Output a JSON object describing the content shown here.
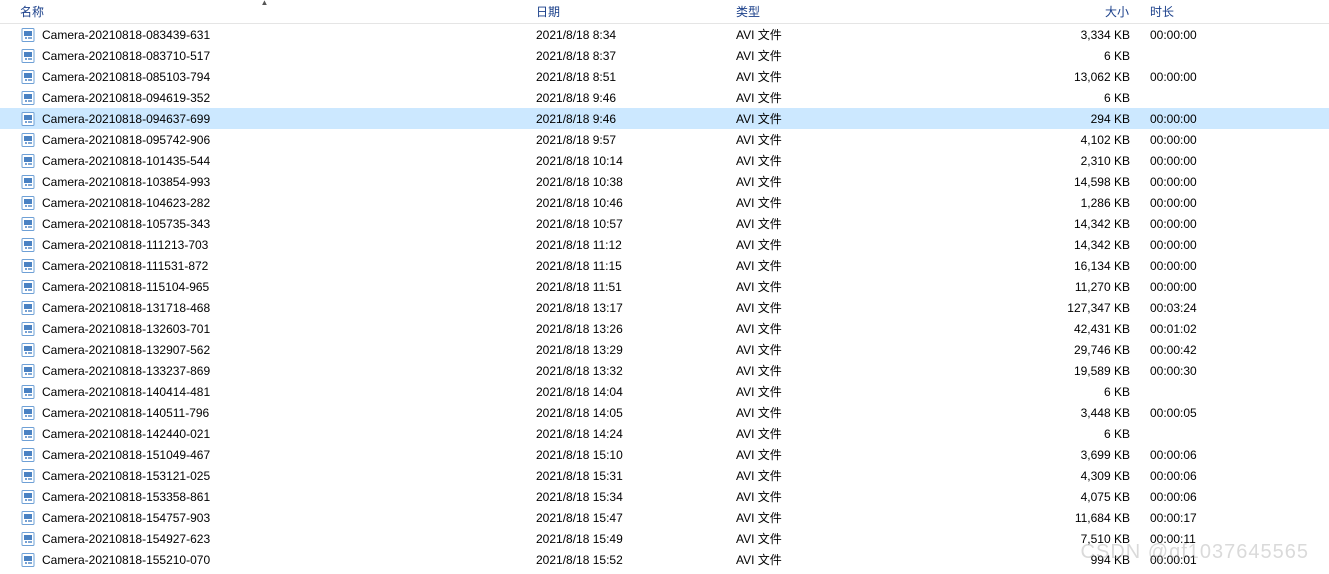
{
  "columns": {
    "name": "名称",
    "date": "日期",
    "type": "类型",
    "size": "大小",
    "duration": "时长"
  },
  "selected_index": 4,
  "watermark": "CSDN @qf1037645565",
  "files": [
    {
      "name": "Camera-20210818-083439-631",
      "date": "2021/8/18 8:34",
      "type": "AVI 文件",
      "size": "3,334 KB",
      "duration": "00:00:00"
    },
    {
      "name": "Camera-20210818-083710-517",
      "date": "2021/8/18 8:37",
      "type": "AVI 文件",
      "size": "6 KB",
      "duration": ""
    },
    {
      "name": "Camera-20210818-085103-794",
      "date": "2021/8/18 8:51",
      "type": "AVI 文件",
      "size": "13,062 KB",
      "duration": "00:00:00"
    },
    {
      "name": "Camera-20210818-094619-352",
      "date": "2021/8/18 9:46",
      "type": "AVI 文件",
      "size": "6 KB",
      "duration": ""
    },
    {
      "name": "Camera-20210818-094637-699",
      "date": "2021/8/18 9:46",
      "type": "AVI 文件",
      "size": "294 KB",
      "duration": "00:00:00"
    },
    {
      "name": "Camera-20210818-095742-906",
      "date": "2021/8/18 9:57",
      "type": "AVI 文件",
      "size": "4,102 KB",
      "duration": "00:00:00"
    },
    {
      "name": "Camera-20210818-101435-544",
      "date": "2021/8/18 10:14",
      "type": "AVI 文件",
      "size": "2,310 KB",
      "duration": "00:00:00"
    },
    {
      "name": "Camera-20210818-103854-993",
      "date": "2021/8/18 10:38",
      "type": "AVI 文件",
      "size": "14,598 KB",
      "duration": "00:00:00"
    },
    {
      "name": "Camera-20210818-104623-282",
      "date": "2021/8/18 10:46",
      "type": "AVI 文件",
      "size": "1,286 KB",
      "duration": "00:00:00"
    },
    {
      "name": "Camera-20210818-105735-343",
      "date": "2021/8/18 10:57",
      "type": "AVI 文件",
      "size": "14,342 KB",
      "duration": "00:00:00"
    },
    {
      "name": "Camera-20210818-111213-703",
      "date": "2021/8/18 11:12",
      "type": "AVI 文件",
      "size": "14,342 KB",
      "duration": "00:00:00"
    },
    {
      "name": "Camera-20210818-111531-872",
      "date": "2021/8/18 11:15",
      "type": "AVI 文件",
      "size": "16,134 KB",
      "duration": "00:00:00"
    },
    {
      "name": "Camera-20210818-115104-965",
      "date": "2021/8/18 11:51",
      "type": "AVI 文件",
      "size": "11,270 KB",
      "duration": "00:00:00"
    },
    {
      "name": "Camera-20210818-131718-468",
      "date": "2021/8/18 13:17",
      "type": "AVI 文件",
      "size": "127,347 KB",
      "duration": "00:03:24"
    },
    {
      "name": "Camera-20210818-132603-701",
      "date": "2021/8/18 13:26",
      "type": "AVI 文件",
      "size": "42,431 KB",
      "duration": "00:01:02"
    },
    {
      "name": "Camera-20210818-132907-562",
      "date": "2021/8/18 13:29",
      "type": "AVI 文件",
      "size": "29,746 KB",
      "duration": "00:00:42"
    },
    {
      "name": "Camera-20210818-133237-869",
      "date": "2021/8/18 13:32",
      "type": "AVI 文件",
      "size": "19,589 KB",
      "duration": "00:00:30"
    },
    {
      "name": "Camera-20210818-140414-481",
      "date": "2021/8/18 14:04",
      "type": "AVI 文件",
      "size": "6 KB",
      "duration": ""
    },
    {
      "name": "Camera-20210818-140511-796",
      "date": "2021/8/18 14:05",
      "type": "AVI 文件",
      "size": "3,448 KB",
      "duration": "00:00:05"
    },
    {
      "name": "Camera-20210818-142440-021",
      "date": "2021/8/18 14:24",
      "type": "AVI 文件",
      "size": "6 KB",
      "duration": ""
    },
    {
      "name": "Camera-20210818-151049-467",
      "date": "2021/8/18 15:10",
      "type": "AVI 文件",
      "size": "3,699 KB",
      "duration": "00:00:06"
    },
    {
      "name": "Camera-20210818-153121-025",
      "date": "2021/8/18 15:31",
      "type": "AVI 文件",
      "size": "4,309 KB",
      "duration": "00:00:06"
    },
    {
      "name": "Camera-20210818-153358-861",
      "date": "2021/8/18 15:34",
      "type": "AVI 文件",
      "size": "4,075 KB",
      "duration": "00:00:06"
    },
    {
      "name": "Camera-20210818-154757-903",
      "date": "2021/8/18 15:47",
      "type": "AVI 文件",
      "size": "11,684 KB",
      "duration": "00:00:17"
    },
    {
      "name": "Camera-20210818-154927-623",
      "date": "2021/8/18 15:49",
      "type": "AVI 文件",
      "size": "7,510 KB",
      "duration": "00:00:11"
    },
    {
      "name": "Camera-20210818-155210-070",
      "date": "2021/8/18 15:52",
      "type": "AVI 文件",
      "size": "994 KB",
      "duration": "00:00:01"
    }
  ]
}
